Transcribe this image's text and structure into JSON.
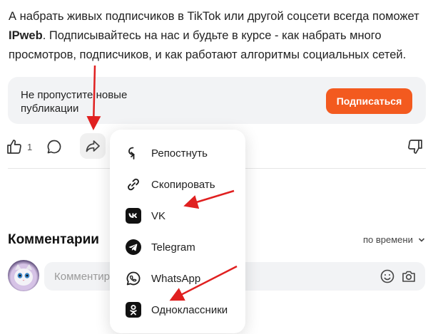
{
  "article": {
    "text_before": "А набрать живых подписчиков в TikTok или другой соцсети всегда поможет ",
    "brand": "IPweb",
    "text_after": ". Подписывайтесь на нас и будьте в курсе - как набрать много просмотров, подписчиков, и как работают алгоритмы социальных сетей."
  },
  "subscribe": {
    "text": "Не пропустите новые публикации",
    "button_label": "Подписаться",
    "button_color": "#f35a1f"
  },
  "actions": {
    "like_count": "1",
    "icons": [
      "like-icon",
      "comment-icon",
      "share-icon",
      "dislike-icon"
    ]
  },
  "share_menu": {
    "items": [
      {
        "label": "Репостнуть",
        "icon": "repost-icon"
      },
      {
        "label": "Скопировать",
        "icon": "link-icon"
      },
      {
        "label": "VK",
        "icon": "vk-icon"
      },
      {
        "label": "Telegram",
        "icon": "telegram-icon"
      },
      {
        "label": "WhatsApp",
        "icon": "whatsapp-icon"
      },
      {
        "label": "Одноклассники",
        "icon": "odnoklassniki-icon"
      }
    ]
  },
  "comments": {
    "title": "Комментарии",
    "sort_label": "по времени",
    "input_placeholder": "Комментировать"
  },
  "colors": {
    "accent": "#f35a1f",
    "annotation_arrow": "#e02020"
  }
}
